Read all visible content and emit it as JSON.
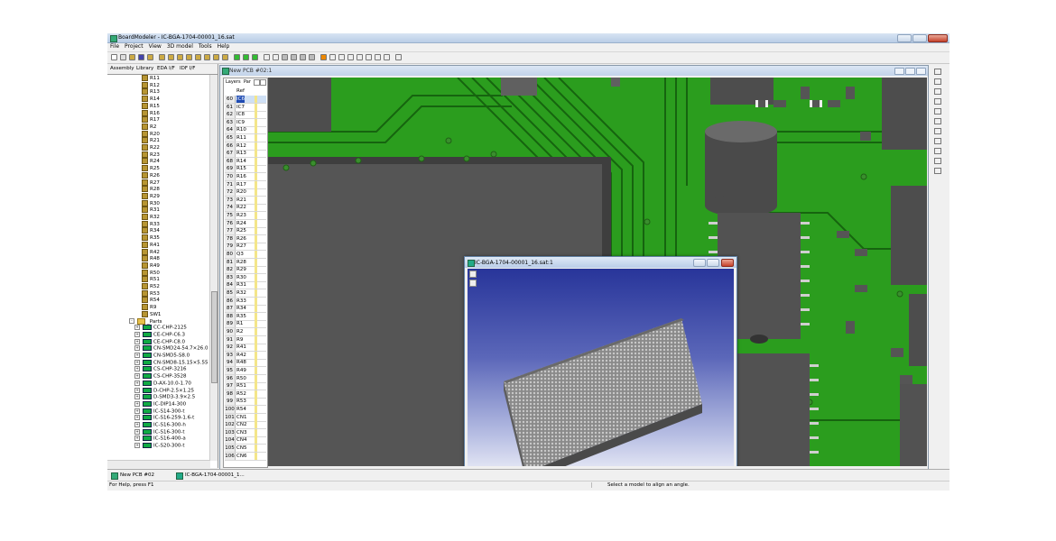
{
  "app": {
    "title": "BoardModeler - IC-BGA-1704-00001_16.sat"
  },
  "menu": [
    "File",
    "Project",
    "View",
    "3D model",
    "Tools",
    "Help"
  ],
  "left_tabs": [
    "Assembly",
    "Library",
    "EDA I/F",
    "IDF I/F"
  ],
  "tree": {
    "resistors": [
      "R11",
      "R12",
      "R13",
      "R14",
      "R15",
      "R16",
      "R17",
      "R2",
      "R20",
      "R21",
      "R22",
      "R23",
      "R24",
      "R25",
      "R26",
      "R27",
      "R28",
      "R29",
      "R30",
      "R31",
      "R32",
      "R33",
      "R34",
      "R35",
      "R41",
      "R42",
      "R48",
      "R49",
      "R50",
      "R51",
      "R52",
      "R53",
      "R54",
      "R9",
      "SW1"
    ],
    "parts_folder": "_Parts",
    "parts": [
      "CC-CHP-2125",
      "CE-CHP-C6.3",
      "CE-CHP-C8.0",
      "CN-SMD24-54.7×26.0",
      "CN-SMD5-S8.0",
      "CN-SMD8-15.15×5.55",
      "CS-CHP-3216",
      "CS-CHP-3528",
      "D-AX-10.0-1.70",
      "D-CHP-2.5×1.25",
      "D-SMD3-3.9×2.5",
      "IC-DIP14-300",
      "IC-S14-300-t",
      "IC-S16-259-1.6-t",
      "IC-S16-300-h",
      "IC-S16-300-t",
      "IC-S16-400-a",
      "IC-S20-300-t"
    ]
  },
  "pcb_window": {
    "title": "New PCB #02:1"
  },
  "layers_panel": {
    "tabs": [
      "Layers",
      "Par"
    ],
    "header_ref": "Ref",
    "rows": [
      {
        "n": "60",
        "ref": "IC6"
      },
      {
        "n": "61",
        "ref": "IC7"
      },
      {
        "n": "62",
        "ref": "IC8"
      },
      {
        "n": "63",
        "ref": "IC9"
      },
      {
        "n": "64",
        "ref": "R10"
      },
      {
        "n": "65",
        "ref": "R11"
      },
      {
        "n": "66",
        "ref": "R12"
      },
      {
        "n": "67",
        "ref": "R13"
      },
      {
        "n": "68",
        "ref": "R14"
      },
      {
        "n": "69",
        "ref": "R15"
      },
      {
        "n": "70",
        "ref": "R16"
      },
      {
        "n": "71",
        "ref": "R17"
      },
      {
        "n": "72",
        "ref": "R20"
      },
      {
        "n": "73",
        "ref": "R21"
      },
      {
        "n": "74",
        "ref": "R22"
      },
      {
        "n": "75",
        "ref": "R23"
      },
      {
        "n": "76",
        "ref": "R24"
      },
      {
        "n": "77",
        "ref": "R25"
      },
      {
        "n": "78",
        "ref": "R26"
      },
      {
        "n": "79",
        "ref": "R27"
      },
      {
        "n": "80",
        "ref": "Q3"
      },
      {
        "n": "81",
        "ref": "R28"
      },
      {
        "n": "82",
        "ref": "R29"
      },
      {
        "n": "83",
        "ref": "R30"
      },
      {
        "n": "84",
        "ref": "R31"
      },
      {
        "n": "85",
        "ref": "R32"
      },
      {
        "n": "86",
        "ref": "R33"
      },
      {
        "n": "87",
        "ref": "R34"
      },
      {
        "n": "88",
        "ref": "R35"
      },
      {
        "n": "89",
        "ref": "R1"
      },
      {
        "n": "90",
        "ref": "R2"
      },
      {
        "n": "91",
        "ref": "R9"
      },
      {
        "n": "92",
        "ref": "R41"
      },
      {
        "n": "93",
        "ref": "R42"
      },
      {
        "n": "94",
        "ref": "R48"
      },
      {
        "n": "95",
        "ref": "R49"
      },
      {
        "n": "96",
        "ref": "R50"
      },
      {
        "n": "97",
        "ref": "R51"
      },
      {
        "n": "98",
        "ref": "R52"
      },
      {
        "n": "99",
        "ref": "R53"
      },
      {
        "n": "100",
        "ref": "R54"
      },
      {
        "n": "101",
        "ref": "CN1"
      },
      {
        "n": "102",
        "ref": "CN2"
      },
      {
        "n": "103",
        "ref": "CN3"
      },
      {
        "n": "104",
        "ref": "CN4"
      },
      {
        "n": "105",
        "ref": "CN5"
      },
      {
        "n": "106",
        "ref": "CN6"
      }
    ]
  },
  "child_window": {
    "title": "IC-BGA-1704-00001_16.sat:1"
  },
  "taskbar": [
    "New PCB #02",
    "IC-BGA-1704-00001_1..."
  ],
  "status": {
    "left": "For Help, press F1",
    "right": "Select a model to align an angle."
  },
  "colors": {
    "pcb_green": "#2b9d1e",
    "trace_green": "#16640f",
    "component_gray": "#5a5a5a",
    "viewport_blue": "#28359a"
  }
}
